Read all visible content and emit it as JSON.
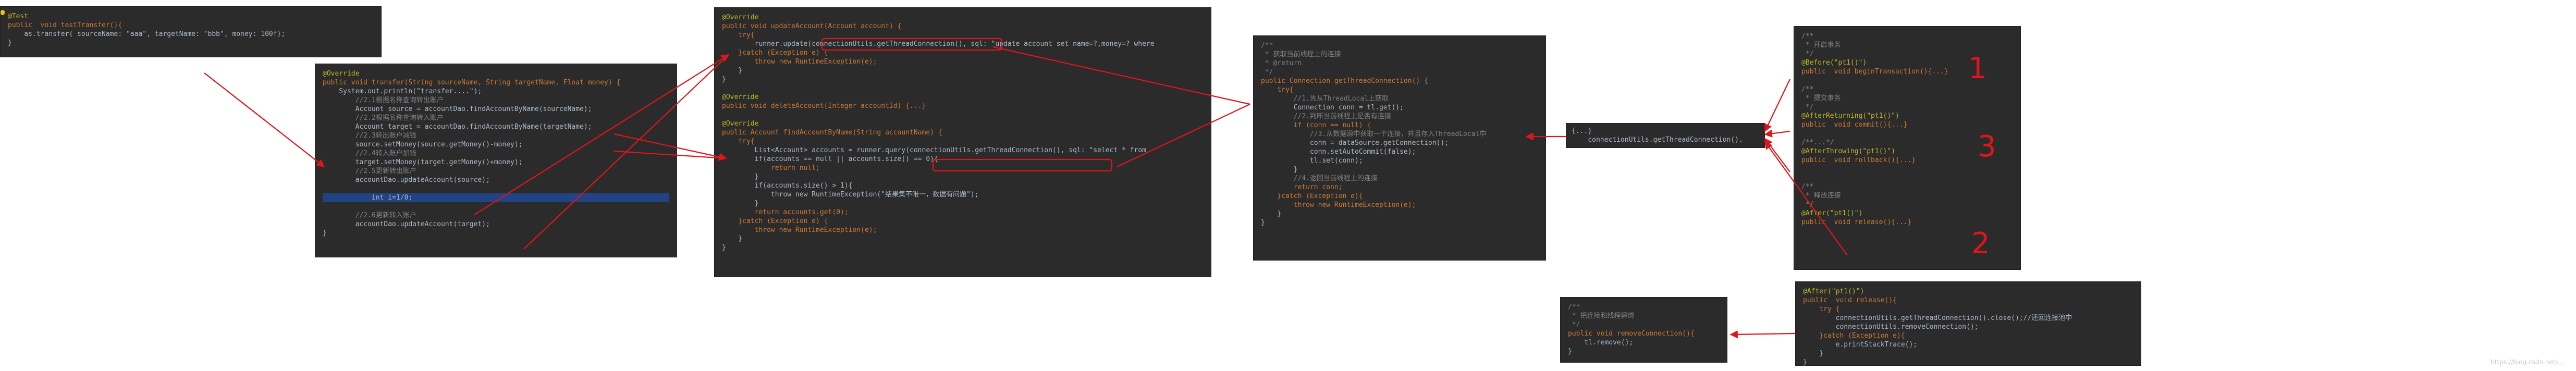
{
  "panels": {
    "test_method": [
      "@Test",
      "public  void testTransfer(){",
      "    as.transfer( sourceName: \"aaa\", targetName: \"bbb\", money: 100f);",
      "}"
    ],
    "transfer_method": [
      "@Override",
      "public void transfer(String sourceName, String targetName, Float money) {",
      "    System.out.println(\"transfer....\");",
      "        //2.1根据名称查询转出账户",
      "        Account source = accountDao.findAccountByName(sourceName);",
      "        //2.2根据名称查询转入账户",
      "        Account target = accountDao.findAccountByName(targetName);",
      "        //2.3转出账户减钱",
      "        source.setMoney(source.getMoney()-money);",
      "        //2.4转入账户加钱",
      "        target.setMoney(target.getMoney()+money);",
      "        //2.5更新转出账户",
      "        accountDao.updateAccount(source);",
      "",
      "            int i=1/0;",
      "",
      "        //2.6更新转入账户",
      "        accountDao.updateAccount(target);",
      "}"
    ],
    "account_dao": [
      "@Override",
      "public void updateAccount(Account account) {",
      "    try{",
      "        runner.update(connectionUtils.getThreadConnection(), sql: \"update account set name=?,money=? where",
      "    }catch (Exception e) {",
      "        throw new RuntimeException(e);",
      "    }",
      "}",
      "",
      "@Override",
      "public void deleteAccount(Integer accountId) {...}",
      "",
      "@Override",
      "public Account findAccountByName(String accountName) {",
      "    try{",
      "        List<Account> accounts = runner.query(connectionUtils.getThreadConnection(), sql: \"select * from",
      "        if(accounts == null || accounts.size() == 0){",
      "            return null;",
      "        }",
      "        if(accounts.size() > 1){",
      "            throw new RuntimeException(\"结果集不唯一，数据有问题\");",
      "        }",
      "        return accounts.get(0);",
      "    }catch (Exception e) {",
      "        throw new RuntimeException(e);",
      "    }",
      "}"
    ],
    "get_thread_connection": [
      "/**",
      " * 获取当前线程上的连接",
      " * @return",
      " */",
      "public Connection getThreadConnection() {",
      "    try{",
      "        //1.先从ThreadLocal上获取",
      "        Connection conn = tl.get();",
      "        //2.判断当前线程上是否有连接",
      "        if (conn == null) {",
      "            //3.从数据源中获取一个连接，并且存入ThreadLocal中",
      "            conn = dataSource.getConnection();",
      "            conn.setAutoCommit(false);",
      "            tl.set(conn);",
      "        }",
      "        //4.返回当前线程上的连接",
      "        return conn;",
      "    }catch (Exception e){",
      "        throw new RuntimeException(e);",
      "    }",
      "}"
    ],
    "call_site": [
      "{...}",
      "    connectionUtils.getThreadConnection()."
    ],
    "transaction_manager": [
      "/**",
      " * 开启事务",
      " */",
      "@Before(\"pt1()\")",
      "public  void beginTransaction(){...}",
      "",
      "/**",
      " * 提交事务",
      " */",
      "@AfterReturning(\"pt1()\")",
      "public  void commit(){...}",
      "",
      "/**...*/",
      "@AfterThrowing(\"pt1()\")",
      "public  void rollback(){...}",
      "",
      "",
      "/**",
      " * 释放连接",
      " */",
      "@After(\"pt1()\")",
      "public  void release(){...}"
    ],
    "remove_connection": [
      "/**",
      " * 把连接和线程解绑",
      " */",
      "public void removeConnection(){",
      "    tl.remove();",
      "}"
    ],
    "release_method": [
      "@After(\"pt1()\")",
      "public  void release(){",
      "    try {",
      "        connectionUtils.getThreadConnection().close();//还回连接池中",
      "        connectionUtils.removeConnection();",
      "    }catch (Exception e){",
      "        e.printStackTrace();",
      "    }",
      "}"
    ]
  },
  "annotations": {
    "mark_1": "1",
    "mark_2": "2",
    "mark_3": "3"
  },
  "colors": {
    "editor_bg": "#2b2b2b",
    "keyword": "#cc7832",
    "annotation": "#bbb529",
    "comment": "#808080",
    "string": "#6a8759",
    "method": "#ffc66d",
    "selection": "#214283",
    "arrow": "#e0151b"
  },
  "watermark": "https://blog.csdn.net/..."
}
